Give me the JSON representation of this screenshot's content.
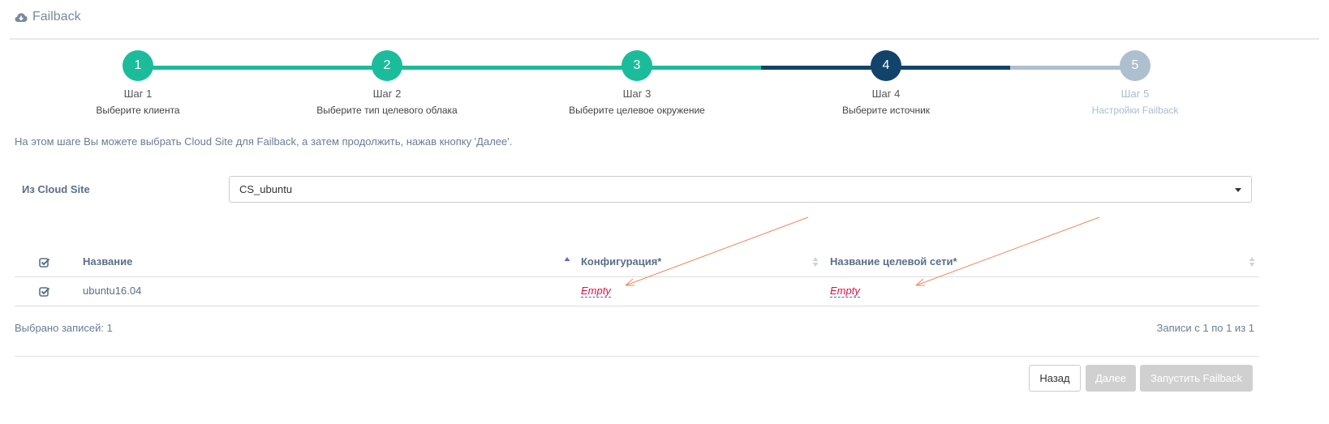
{
  "header": {
    "title": "Failback",
    "icon": "cloud-download-icon"
  },
  "wizard": {
    "steps": [
      {
        "number": "1",
        "title": "Шаг 1",
        "subtitle": "Выберите клиента",
        "state": "done"
      },
      {
        "number": "2",
        "title": "Шаг 2",
        "subtitle": "Выберите тип целевого облака",
        "state": "done"
      },
      {
        "number": "3",
        "title": "Шаг 3",
        "subtitle": "Выберите целевое окружение",
        "state": "done"
      },
      {
        "number": "4",
        "title": "Шаг 4",
        "subtitle": "Выберите источник",
        "state": "active"
      },
      {
        "number": "5",
        "title": "Шаг 5",
        "subtitle": "Настройки Failback",
        "state": "pending"
      }
    ],
    "colors": {
      "done": "#1bbc9b",
      "active": "#12436b",
      "pending": "#aebfd0"
    }
  },
  "info_text": "На этом шаге Вы можете выбрать Cloud Site для Failback, а затем продолжить, нажав кнопку 'Далее'.",
  "source": {
    "label": "Из Cloud Site",
    "selected": "CS_ubuntu"
  },
  "table": {
    "columns": [
      "Название",
      "Конфигурация*",
      "Название целевой сети*"
    ],
    "rows": [
      {
        "name": "ubuntu16.04",
        "configuration": "Empty",
        "network": "Empty"
      }
    ]
  },
  "footer": {
    "selected_count": "Выбрано записей: 1",
    "records_info": "Записи с 1 по 1 из 1"
  },
  "buttons": {
    "back": "Назад",
    "next": "Далее",
    "run": "Запустить Failback"
  },
  "colors": {
    "empty_link": "#dd1144",
    "annotation_arrow": "#f08a5d"
  }
}
